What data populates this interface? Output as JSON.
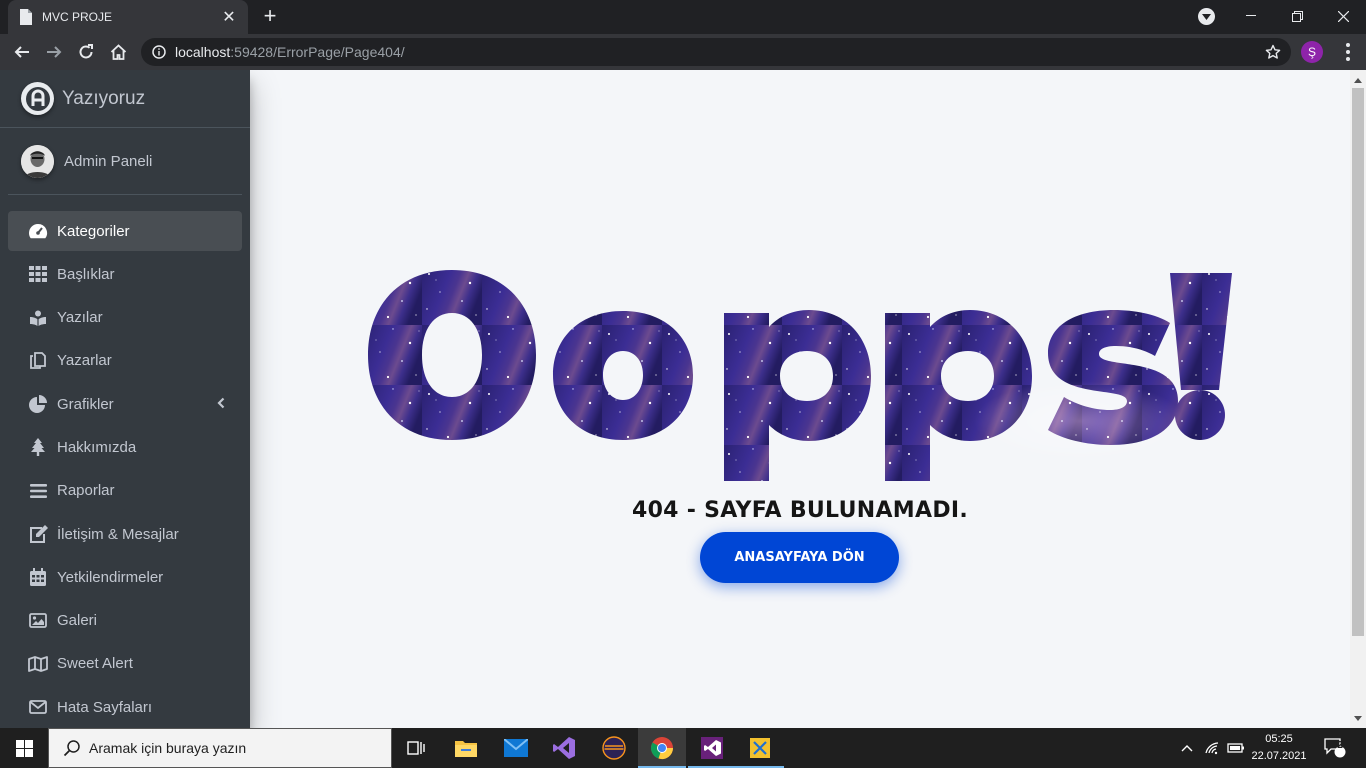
{
  "browser": {
    "tab_title": "MVC PROJE",
    "url_host": "localhost",
    "url_path": ":59428/ErrorPage/Page404/",
    "profile_initial": "Ş"
  },
  "sidebar": {
    "brand": "Yazıyoruz",
    "user": "Admin Paneli",
    "items": [
      {
        "label": "Kategoriler",
        "icon": "tachometer-icon",
        "active": true
      },
      {
        "label": "Başlıklar",
        "icon": "grid-icon"
      },
      {
        "label": "Yazılar",
        "icon": "reader-icon"
      },
      {
        "label": "Yazarlar",
        "icon": "copy-icon"
      },
      {
        "label": "Grafikler",
        "icon": "pie-chart-icon",
        "has_submenu": true
      },
      {
        "label": "Hakkımızda",
        "icon": "tree-icon"
      },
      {
        "label": "Raporlar",
        "icon": "bars-icon"
      },
      {
        "label": "İletişim & Mesajlar",
        "icon": "edit-icon"
      },
      {
        "label": "Yetkilendirmeler",
        "icon": "calendar-icon"
      },
      {
        "label": "Galeri",
        "icon": "image-icon"
      },
      {
        "label": "Sweet Alert",
        "icon": "map-icon"
      },
      {
        "label": "Hata Sayfaları",
        "icon": "envelope-icon"
      }
    ]
  },
  "error": {
    "headline": "Oopps!",
    "message": "404 - SAYFA BULUNAMADI.",
    "button": "ANASAYFAYA DÖN"
  },
  "taskbar": {
    "search_placeholder": "Aramak için buraya yazın",
    "time": "05:25",
    "date": "22.07.2021",
    "notification_count": "2"
  },
  "colors": {
    "sidebar_bg": "#343a40",
    "content_bg": "#f4f6f9",
    "button_bg": "#0046d5",
    "galaxy_dark": "#241a5e",
    "galaxy_mid": "#3b2c8f"
  }
}
